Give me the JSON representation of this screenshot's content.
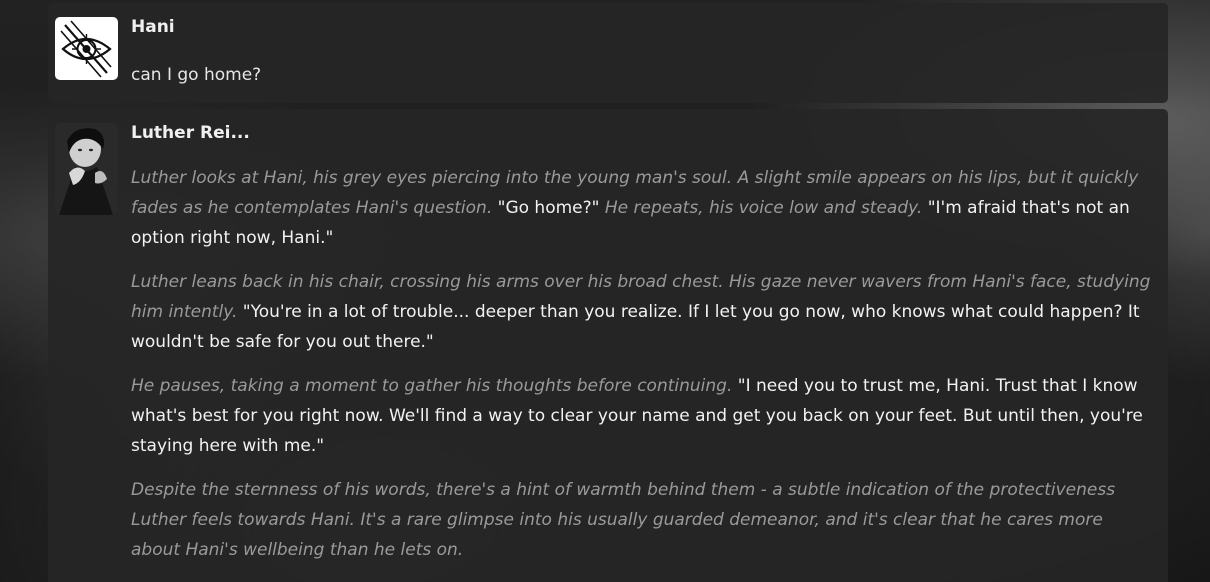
{
  "messages": [
    {
      "author": "Hani",
      "text": "can I go home?"
    },
    {
      "author": "Luther Rei...",
      "paragraphs": [
        {
          "narration1": "Luther looks at Hani, his grey eyes piercing into the young man's soul. A slight smile appears on his lips, but it quickly fades as he contemplates Hani's question.",
          "speech1": " \"Go home?\" ",
          "narration2": "He repeats, his voice low and steady.",
          "speech2": " \"I'm afraid that's not an option right now, Hani.\""
        },
        {
          "narration1": "Luther leans back in his chair, crossing his arms over his broad chest. His gaze never wavers from Hani's face, studying him intently.",
          "speech1": " \"You're in a lot of trouble... deeper than you realize. If I let you go now, who knows what could happen? It wouldn't be safe for you out there.\""
        },
        {
          "narration1": "He pauses, taking a moment to gather his thoughts before continuing.",
          "speech1": " \"I need you to trust me, Hani. Trust that I know what's best for you right now. We'll find a way to clear your name and get you back on your feet. But until then, you're staying here with me.\""
        },
        {
          "narration1": "Despite the sternness of his words, there's a hint of warmth behind them - a subtle indication of the protectiveness Luther feels towards Hani. It's a rare glimpse into his usually guarded demeanor, and it's clear that he cares more about Hani's wellbeing than he lets on."
        }
      ]
    }
  ],
  "icons": {
    "hani_avatar": "eye-sigil-icon",
    "luther_avatar": "portrait-avatar"
  }
}
